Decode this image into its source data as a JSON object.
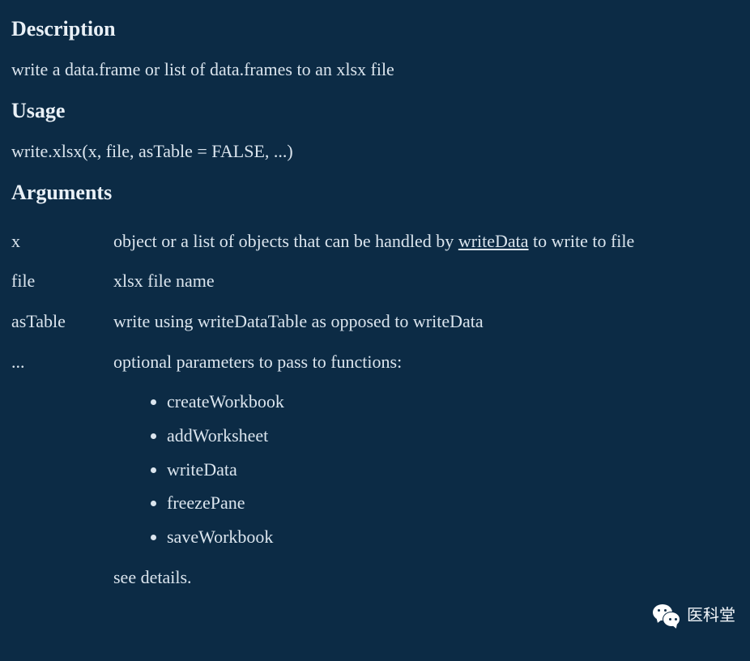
{
  "sections": {
    "description_heading": "Description",
    "usage_heading": "Usage",
    "arguments_heading": "Arguments"
  },
  "description_text": "write a data.frame or list of data.frames to an xlsx file",
  "usage_text": "write.xlsx(x, file, asTable = FALSE, ...)",
  "arguments": {
    "x": {
      "name": "x",
      "desc_pre": "object or a list of objects that can be handled by ",
      "link": "writeData",
      "desc_post": " to write to file"
    },
    "file": {
      "name": "file",
      "desc": "xlsx file name"
    },
    "asTable": {
      "name": "asTable",
      "desc": "write using writeDataTable as opposed to writeData"
    },
    "dots": {
      "name": "...",
      "desc_pre": "optional parameters to pass to functions:",
      "functions": [
        "createWorkbook",
        "addWorksheet",
        "writeData",
        "freezePane",
        "saveWorkbook"
      ],
      "desc_post": "see details."
    }
  },
  "watermark": {
    "label": "医科堂",
    "icon": "wechat-icon"
  }
}
